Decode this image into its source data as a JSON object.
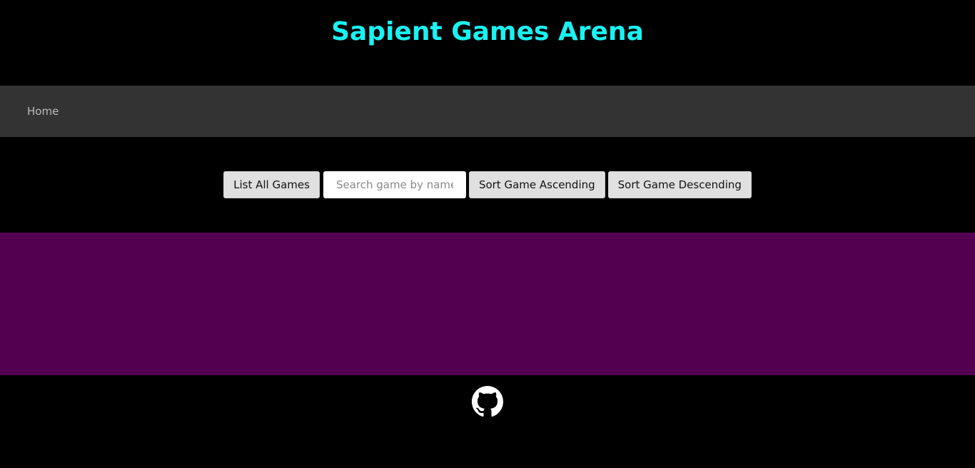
{
  "header": {
    "title": "Sapient Games Arena",
    "title_color": "#19f2f2"
  },
  "nav": {
    "home_label": "Home"
  },
  "controls": {
    "list_all_label": "List All Games",
    "search_placeholder": "Search game by names",
    "search_value": "",
    "sort_asc_label": "Sort Game Ascending",
    "sort_desc_label": "Sort Game Descending"
  },
  "games_area": {
    "background": "#530051"
  },
  "footer": {
    "icon": "github-icon"
  }
}
